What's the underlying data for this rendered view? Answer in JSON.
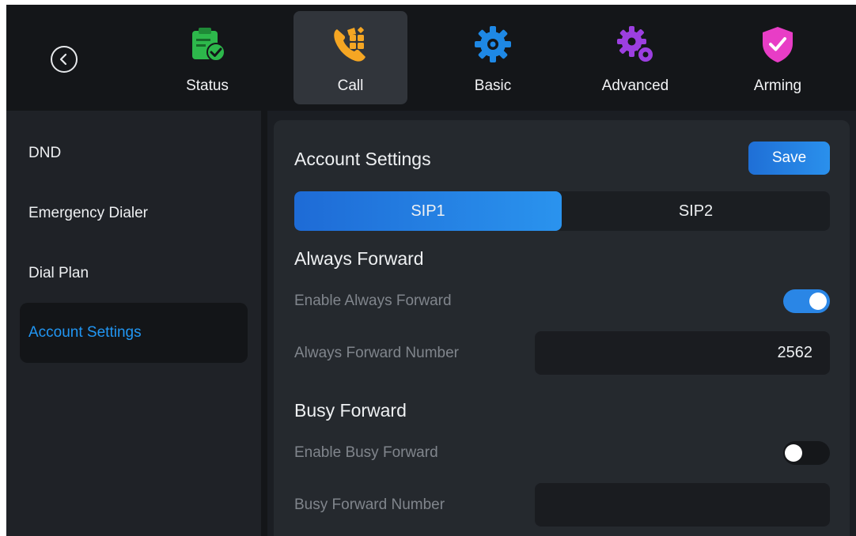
{
  "nav": {
    "back_icon": "chevron-left-icon",
    "tabs": [
      {
        "label": "Status",
        "icon": "clipboard-check-icon",
        "color": "#2db84b",
        "active": false
      },
      {
        "label": "Call",
        "icon": "phone-grid-icon",
        "color": "#f5a623",
        "active": true
      },
      {
        "label": "Basic",
        "icon": "gear-icon",
        "color": "#1e88e5",
        "active": false
      },
      {
        "label": "Advanced",
        "icon": "gears-icon",
        "color": "#9c3fe0",
        "active": false
      },
      {
        "label": "Arming",
        "icon": "shield-check-icon",
        "color": "#e83dc6",
        "active": false
      }
    ]
  },
  "sidebar": {
    "items": [
      {
        "label": "DND",
        "active": false
      },
      {
        "label": "Emergency Dialer",
        "active": false
      },
      {
        "label": "Dial Plan",
        "active": false
      },
      {
        "label": "Account Settings",
        "active": true
      }
    ]
  },
  "panel": {
    "title": "Account Settings",
    "save_label": "Save",
    "segments": [
      {
        "label": "SIP1",
        "selected": true
      },
      {
        "label": "SIP2",
        "selected": false
      }
    ],
    "always": {
      "heading": "Always Forward",
      "enable_label": "Enable Always Forward",
      "enabled": true,
      "number_label": "Always Forward Number",
      "number_value": "2562"
    },
    "busy": {
      "heading": "Busy Forward",
      "enable_label": "Enable Busy Forward",
      "enabled": false,
      "number_label": "Busy Forward Number",
      "number_value": ""
    }
  },
  "colors": {
    "accent": "#2196f3",
    "background": "#1b1e23",
    "panel": "#25292e"
  }
}
